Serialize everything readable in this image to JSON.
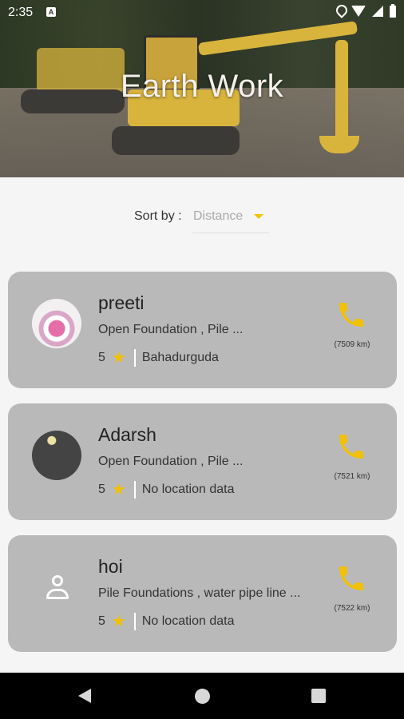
{
  "status_bar": {
    "time": "2:35",
    "app_icon": "A"
  },
  "header": {
    "title": "Earth Work"
  },
  "sort": {
    "label": "Sort by :",
    "value": "Distance"
  },
  "contractors": [
    {
      "name": "preeti",
      "services": "Open Foundation , Pile ...",
      "rating": "5",
      "location": "Bahadurguda",
      "distance": "(7509 km)",
      "avatar": "photo"
    },
    {
      "name": "Adarsh",
      "services": "Open Foundation , Pile ...",
      "rating": "5",
      "location": "No location data",
      "distance": "(7521 km)",
      "avatar": "photo"
    },
    {
      "name": "hoi",
      "services": "Pile Foundations , water pipe line ...",
      "rating": "5",
      "location": "No location data",
      "distance": "(7522 km)",
      "avatar": "person-icon"
    }
  ],
  "colors": {
    "accent": "#f2c200",
    "card": "#b9b9b9",
    "background": "#f5f5f5"
  }
}
